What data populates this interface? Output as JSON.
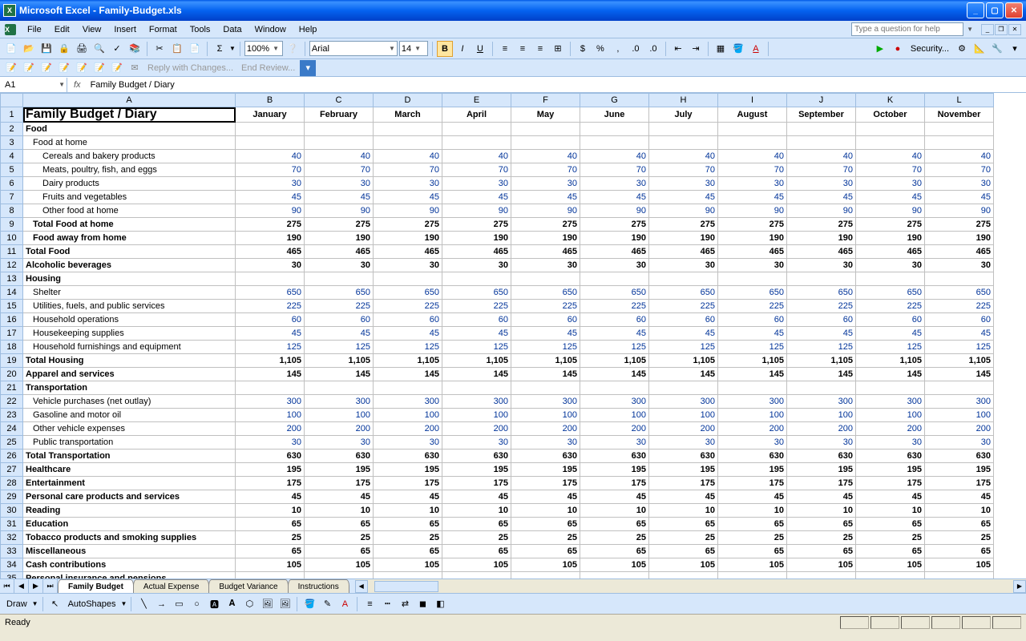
{
  "window": {
    "title": "Microsoft Excel - Family-Budget.xls"
  },
  "menu": {
    "items": [
      "File",
      "Edit",
      "View",
      "Insert",
      "Format",
      "Tools",
      "Data",
      "Window",
      "Help"
    ],
    "help_placeholder": "Type a question for help"
  },
  "toolbar_main": {
    "zoom": "100%",
    "font": "Arial",
    "size": "14"
  },
  "reviewbar": {
    "reply": "Reply with Changes...",
    "end": "End Review..."
  },
  "security_label": "Security...",
  "namebox": "A1",
  "formula": "Family Budget / Diary",
  "columns": [
    "A",
    "B",
    "C",
    "D",
    "E",
    "F",
    "G",
    "H",
    "I",
    "J",
    "K",
    "L"
  ],
  "months": [
    "January",
    "February",
    "March",
    "April",
    "May",
    "June",
    "July",
    "August",
    "September",
    "October",
    "November"
  ],
  "rows": [
    {
      "n": 1,
      "label": "Family Budget / Diary",
      "type": "title"
    },
    {
      "n": 2,
      "label": "Food",
      "type": "bold"
    },
    {
      "n": 3,
      "label": "Food at home",
      "type": "normal",
      "ind": 1
    },
    {
      "n": 4,
      "label": "Cereals and bakery products",
      "ind": 2,
      "v": [
        40,
        40,
        40,
        40,
        40,
        40,
        40,
        40,
        40,
        40,
        40
      ]
    },
    {
      "n": 5,
      "label": "Meats, poultry, fish, and eggs",
      "ind": 2,
      "v": [
        70,
        70,
        70,
        70,
        70,
        70,
        70,
        70,
        70,
        70,
        70
      ]
    },
    {
      "n": 6,
      "label": "Dairy products",
      "ind": 2,
      "v": [
        30,
        30,
        30,
        30,
        30,
        30,
        30,
        30,
        30,
        30,
        30
      ]
    },
    {
      "n": 7,
      "label": "Fruits and vegetables",
      "ind": 2,
      "v": [
        45,
        45,
        45,
        45,
        45,
        45,
        45,
        45,
        45,
        45,
        45
      ]
    },
    {
      "n": 8,
      "label": "Other food at home",
      "ind": 2,
      "v": [
        90,
        90,
        90,
        90,
        90,
        90,
        90,
        90,
        90,
        90,
        90
      ]
    },
    {
      "n": 9,
      "label": "Total Food at home",
      "type": "bold",
      "ind": 1,
      "v": [
        275,
        275,
        275,
        275,
        275,
        275,
        275,
        275,
        275,
        275,
        275
      ],
      "black": true
    },
    {
      "n": 10,
      "label": "Food away from home",
      "type": "bold",
      "ind": 1,
      "v": [
        190,
        190,
        190,
        190,
        190,
        190,
        190,
        190,
        190,
        190,
        190
      ]
    },
    {
      "n": 11,
      "label": "Total Food",
      "type": "bold",
      "v": [
        465,
        465,
        465,
        465,
        465,
        465,
        465,
        465,
        465,
        465,
        465
      ],
      "black": true
    },
    {
      "n": 12,
      "label": "Alcoholic beverages",
      "type": "bold",
      "v": [
        30,
        30,
        30,
        30,
        30,
        30,
        30,
        30,
        30,
        30,
        30
      ]
    },
    {
      "n": 13,
      "label": "Housing",
      "type": "bold"
    },
    {
      "n": 14,
      "label": "Shelter",
      "ind": 1,
      "v": [
        650,
        650,
        650,
        650,
        650,
        650,
        650,
        650,
        650,
        650,
        650
      ]
    },
    {
      "n": 15,
      "label": "Utilities, fuels, and public services",
      "ind": 1,
      "v": [
        225,
        225,
        225,
        225,
        225,
        225,
        225,
        225,
        225,
        225,
        225
      ]
    },
    {
      "n": 16,
      "label": "Household operations",
      "ind": 1,
      "v": [
        60,
        60,
        60,
        60,
        60,
        60,
        60,
        60,
        60,
        60,
        60
      ]
    },
    {
      "n": 17,
      "label": "Housekeeping supplies",
      "ind": 1,
      "v": [
        45,
        45,
        45,
        45,
        45,
        45,
        45,
        45,
        45,
        45,
        45
      ]
    },
    {
      "n": 18,
      "label": "Household furnishings and equipment",
      "ind": 1,
      "v": [
        125,
        125,
        125,
        125,
        125,
        125,
        125,
        125,
        125,
        125,
        125
      ]
    },
    {
      "n": 19,
      "label": "Total Housing",
      "type": "bold",
      "v": [
        "1,105",
        "1,105",
        "1,105",
        "1,105",
        "1,105",
        "1,105",
        "1,105",
        "1,105",
        "1,105",
        "1,105",
        "1,105"
      ],
      "black": true
    },
    {
      "n": 20,
      "label": "Apparel and services",
      "type": "bold",
      "v": [
        145,
        145,
        145,
        145,
        145,
        145,
        145,
        145,
        145,
        145,
        145
      ]
    },
    {
      "n": 21,
      "label": "Transportation",
      "type": "bold"
    },
    {
      "n": 22,
      "label": "Vehicle purchases (net outlay)",
      "ind": 1,
      "v": [
        300,
        300,
        300,
        300,
        300,
        300,
        300,
        300,
        300,
        300,
        300
      ]
    },
    {
      "n": 23,
      "label": "Gasoline and motor oil",
      "ind": 1,
      "v": [
        100,
        100,
        100,
        100,
        100,
        100,
        100,
        100,
        100,
        100,
        100
      ]
    },
    {
      "n": 24,
      "label": "Other vehicle expenses",
      "ind": 1,
      "v": [
        200,
        200,
        200,
        200,
        200,
        200,
        200,
        200,
        200,
        200,
        200
      ]
    },
    {
      "n": 25,
      "label": "Public transportation",
      "ind": 1,
      "v": [
        30,
        30,
        30,
        30,
        30,
        30,
        30,
        30,
        30,
        30,
        30
      ]
    },
    {
      "n": 26,
      "label": "Total Transportation",
      "type": "bold",
      "v": [
        630,
        630,
        630,
        630,
        630,
        630,
        630,
        630,
        630,
        630,
        630
      ],
      "black": true
    },
    {
      "n": 27,
      "label": "Healthcare",
      "type": "bold",
      "v": [
        195,
        195,
        195,
        195,
        195,
        195,
        195,
        195,
        195,
        195,
        195
      ]
    },
    {
      "n": 28,
      "label": "Entertainment",
      "type": "bold",
      "v": [
        175,
        175,
        175,
        175,
        175,
        175,
        175,
        175,
        175,
        175,
        175
      ]
    },
    {
      "n": 29,
      "label": "Personal care products and services",
      "type": "bold",
      "v": [
        45,
        45,
        45,
        45,
        45,
        45,
        45,
        45,
        45,
        45,
        45
      ]
    },
    {
      "n": 30,
      "label": "Reading",
      "type": "bold",
      "v": [
        10,
        10,
        10,
        10,
        10,
        10,
        10,
        10,
        10,
        10,
        10
      ]
    },
    {
      "n": 31,
      "label": "Education",
      "type": "bold",
      "v": [
        65,
        65,
        65,
        65,
        65,
        65,
        65,
        65,
        65,
        65,
        65
      ]
    },
    {
      "n": 32,
      "label": "Tobacco products and smoking supplies",
      "type": "bold",
      "v": [
        25,
        25,
        25,
        25,
        25,
        25,
        25,
        25,
        25,
        25,
        25
      ]
    },
    {
      "n": 33,
      "label": "Miscellaneous",
      "type": "bold",
      "v": [
        65,
        65,
        65,
        65,
        65,
        65,
        65,
        65,
        65,
        65,
        65
      ]
    },
    {
      "n": 34,
      "label": "Cash contributions",
      "type": "bold",
      "v": [
        105,
        105,
        105,
        105,
        105,
        105,
        105,
        105,
        105,
        105,
        105
      ]
    },
    {
      "n": 35,
      "label": "Personal insurance and pensions",
      "type": "bold"
    }
  ],
  "sheets": {
    "tabs": [
      "Family Budget",
      "Actual Expense",
      "Budget Variance",
      "Instructions"
    ],
    "active": 0
  },
  "drawbar": {
    "draw": "Draw",
    "autoshapes": "AutoShapes"
  },
  "status": "Ready"
}
